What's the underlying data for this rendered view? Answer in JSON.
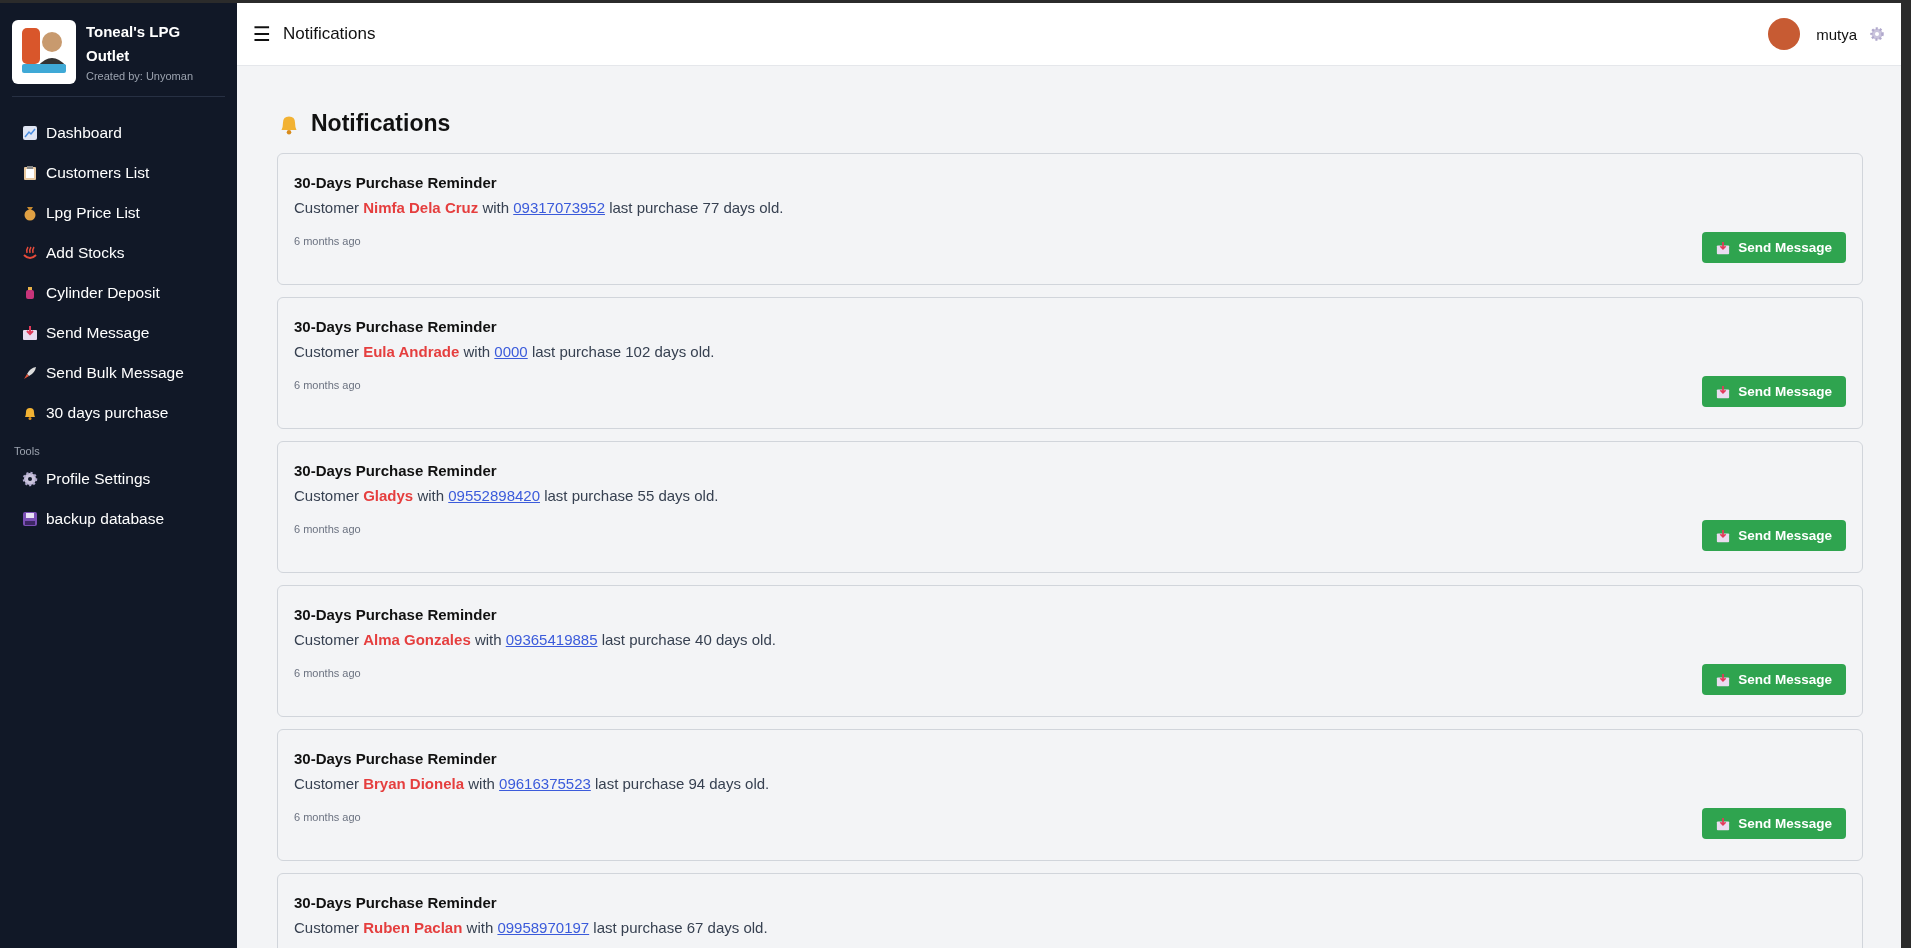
{
  "sidebar": {
    "brand": {
      "title": "Toneal's LPG Outlet",
      "subtitle": "Created by: Unyoman"
    },
    "items": [
      {
        "label": "Dashboard"
      },
      {
        "label": "Customers List"
      },
      {
        "label": "Lpg Price List"
      },
      {
        "label": "Add Stocks"
      },
      {
        "label": "Cylinder Deposit"
      },
      {
        "label": "Send Message"
      },
      {
        "label": "Send Bulk Message"
      },
      {
        "label": "30 days purchase"
      }
    ],
    "section_label": "Tools",
    "tools": [
      {
        "label": "Profile Settings"
      },
      {
        "label": "backup database"
      }
    ]
  },
  "header": {
    "menu_glyph": "☰",
    "title": "Notifications",
    "user": "mutya"
  },
  "page_title": "Notifications",
  "notifications": [
    {
      "title": "30-Days Purchase Reminder",
      "prefix": "Customer",
      "name": "Nimfa Dela Cruz",
      "joiner": "with",
      "phone": "09317073952",
      "tail": "last purchase 77 days old.",
      "time": "6 months ago",
      "button": "Send Message"
    },
    {
      "title": "30-Days Purchase Reminder",
      "prefix": "Customer",
      "name": "Eula Andrade",
      "joiner": "with",
      "phone": "0000",
      "tail": "last purchase 102 days old.",
      "time": "6 months ago",
      "button": "Send Message"
    },
    {
      "title": "30-Days Purchase Reminder",
      "prefix": "Customer",
      "name": "Gladys",
      "joiner": "with",
      "phone": "09552898420",
      "tail": "last purchase 55 days old.",
      "time": "6 months ago",
      "button": "Send Message"
    },
    {
      "title": "30-Days Purchase Reminder",
      "prefix": "Customer",
      "name": "Alma Gonzales",
      "joiner": "with",
      "phone": "09365419885",
      "tail": "last purchase 40 days old.",
      "time": "6 months ago",
      "button": "Send Message"
    },
    {
      "title": "30-Days Purchase Reminder",
      "prefix": "Customer",
      "name": "Bryan Dionela",
      "joiner": "with",
      "phone": "09616375523",
      "tail": "last purchase 94 days old.",
      "time": "6 months ago",
      "button": "Send Message"
    },
    {
      "title": "30-Days Purchase Reminder",
      "prefix": "Customer",
      "name": "Ruben Paclan",
      "joiner": "with",
      "phone": "09958970197",
      "tail": "last purchase 67 days old."
    }
  ]
}
